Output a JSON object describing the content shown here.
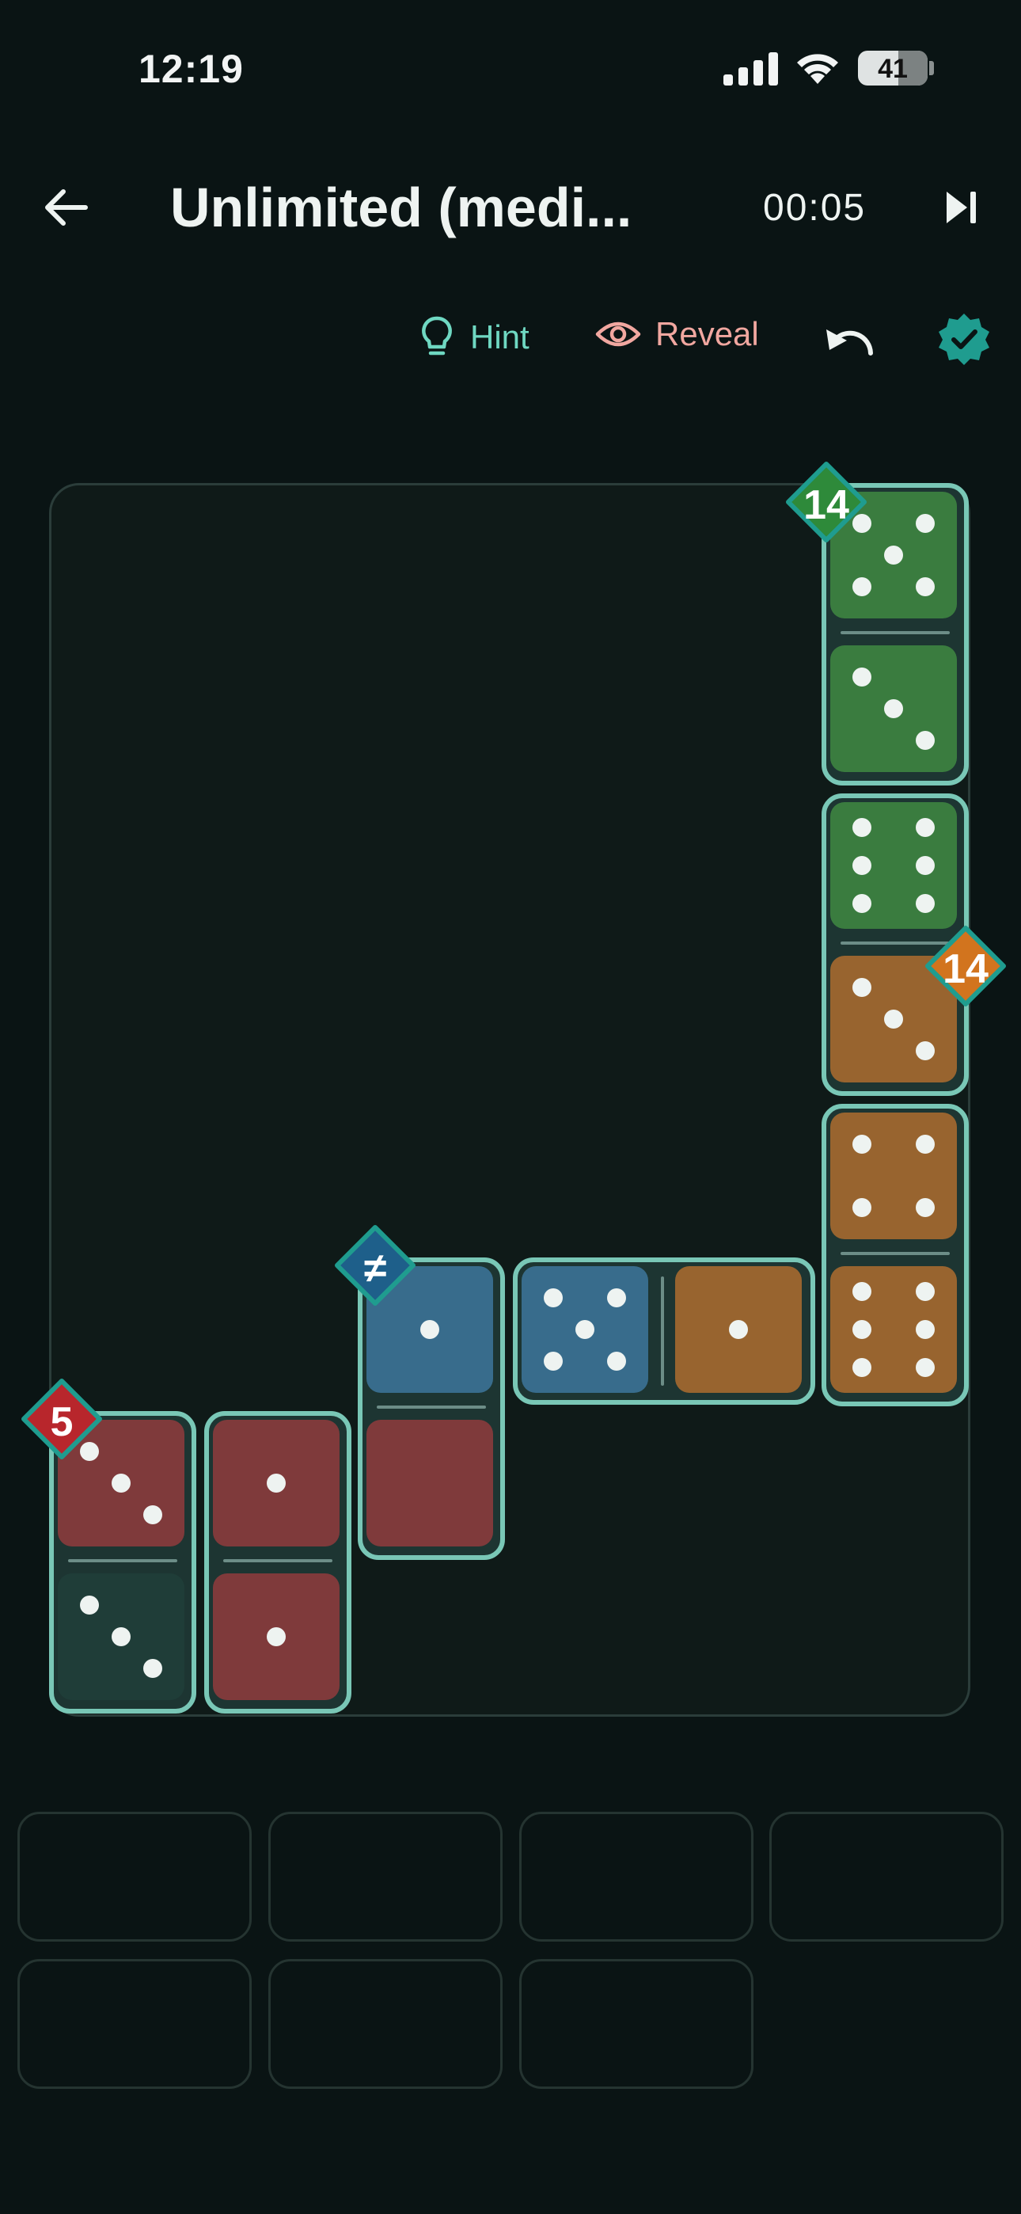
{
  "status_bar": {
    "time": "12:19",
    "battery": "41"
  },
  "header": {
    "title": "Unlimited (medi...",
    "timer": "00:05"
  },
  "toolbar": {
    "hint": "Hint",
    "reveal": "Reveal"
  },
  "colors": {
    "background": "#0a1414",
    "accent": "#6fd8c2",
    "reveal": "#f1a7a0",
    "green": "#3a7c3f",
    "orange": "#98642f",
    "red": "#7f3a3b",
    "blue": "#386c8c",
    "domino_border": "#79c7b6"
  },
  "regions": [
    {
      "constraint": "14",
      "color": "green"
    },
    {
      "constraint": "14",
      "color": "orange"
    },
    {
      "constraint": "≠",
      "color": "blue"
    },
    {
      "constraint": "5",
      "color": "red"
    }
  ],
  "dominoes": [
    {
      "pips": [
        5,
        3
      ]
    },
    {
      "pips": [
        6,
        3
      ]
    },
    {
      "pips": [
        4,
        6
      ]
    },
    {
      "pips": [
        5,
        1
      ]
    },
    {
      "pips": [
        1,
        0
      ]
    },
    {
      "pips": [
        3,
        3
      ]
    },
    {
      "pips": [
        1,
        1
      ]
    }
  ],
  "tray": {
    "empty_slots": 7
  }
}
